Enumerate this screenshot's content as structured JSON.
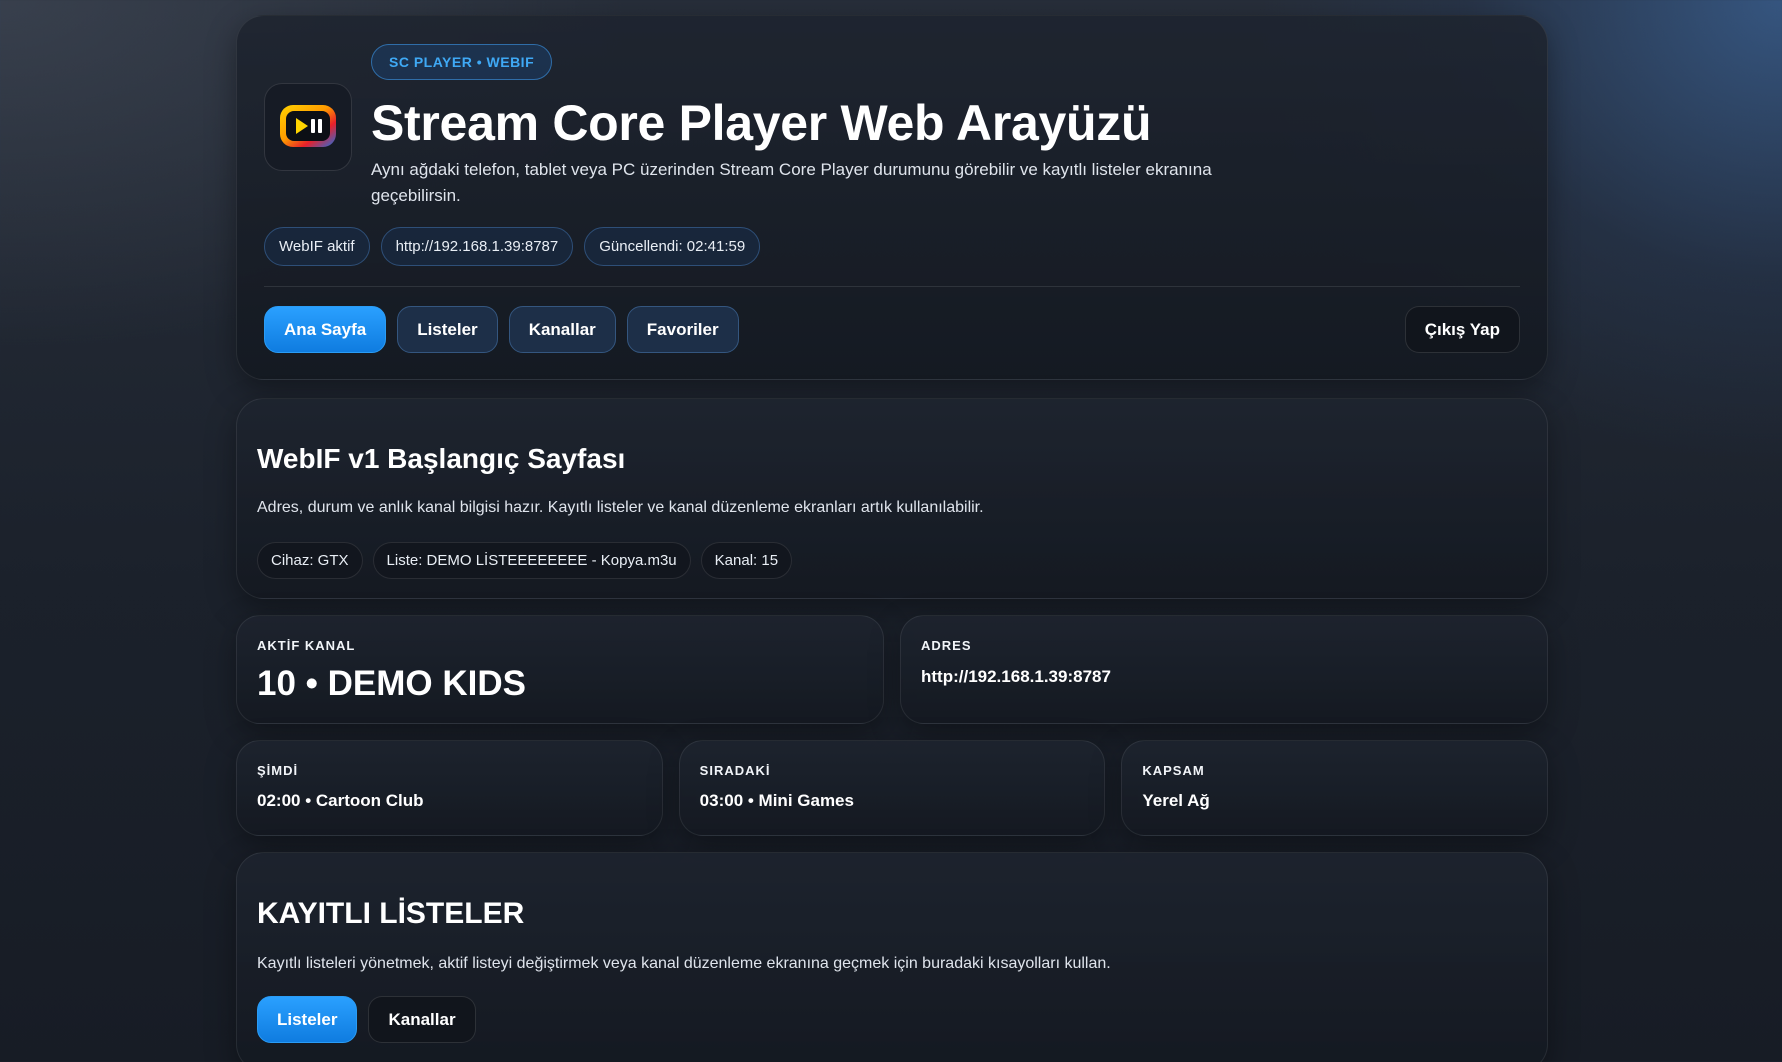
{
  "header": {
    "eyebrow": "SC PLAYER • WEBIF",
    "title": "Stream Core Player Web Arayüzü",
    "description": "Aynı ağdaki telefon, tablet veya PC üzerinden Stream Core Player durumunu görebilir ve kayıtlı listeler ekranına geçebilirsin.",
    "status_chips": [
      "WebIF aktif",
      "http://192.168.1.39:8787",
      "Güncellendi: 02:41:59"
    ],
    "nav": [
      "Ana Sayfa",
      "Listeler",
      "Kanallar",
      "Favoriler"
    ],
    "logout": "Çıkış Yap",
    "logo_icon": "play-pause-tv-icon"
  },
  "home": {
    "title": "WebIF v1 Başlangıç Sayfası",
    "subtitle": "Adres, durum ve anlık kanal bilgisi hazır. Kayıtlı listeler ve kanal düzenleme ekranları artık kullanılabilir.",
    "tags": [
      "Cihaz: GTX",
      "Liste: DEMO LİSTEEEEEEEE - Kopya.m3u",
      "Kanal: 15"
    ]
  },
  "active_channel": {
    "label": "AKTİF KANAL",
    "value": "10 • DEMO KIDS"
  },
  "address": {
    "label": "ADRES",
    "value": "http://192.168.1.39:8787"
  },
  "now": {
    "label": "ŞİMDİ",
    "value": "02:00 • Cartoon Club"
  },
  "next": {
    "label": "SIRADAKİ",
    "value": "03:00 • Mini Games"
  },
  "scope": {
    "label": "KAPSAM",
    "value": "Yerel Ağ"
  },
  "saved_lists": {
    "title": "KAYITLI LİSTELER",
    "subtitle": "Kayıtlı listeleri yönetmek, aktif listeyi değiştirmek veya kanal düzenleme ekranına geçmek için buradaki kısayolları kullan.",
    "buttons": [
      "Listeler",
      "Kanallar"
    ]
  },
  "colors": {
    "accent": "#1a8ff0",
    "eyebrow_text": "#3fa9f5",
    "background": "#1b212b"
  }
}
